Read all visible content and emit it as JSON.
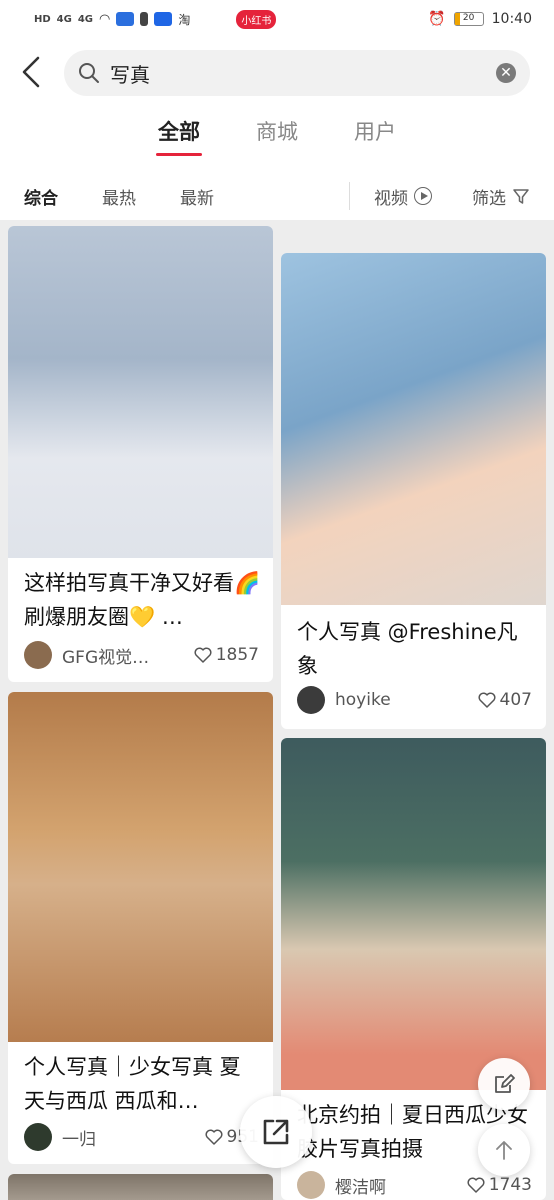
{
  "status_bar": {
    "network": "HD",
    "signal1": "4G",
    "signal2": "4G",
    "app_badge": "小红书",
    "battery": "20",
    "time": "10:40"
  },
  "search": {
    "query": "写真"
  },
  "tabs": [
    {
      "label": "全部",
      "active": true
    },
    {
      "label": "商城",
      "active": false
    },
    {
      "label": "用户",
      "active": false
    }
  ],
  "filters": {
    "items": [
      "综合",
      "最热",
      "最新"
    ],
    "video_label": "视频",
    "screen_label": "筛选"
  },
  "cards": [
    {
      "title": "这样拍写真干净又好看🌈刷爆朋友圈💛 …",
      "author": "GFG视觉…",
      "likes": "1857"
    },
    {
      "title": "个人写真 @Freshine凡象",
      "author": "hoyike",
      "likes": "407"
    },
    {
      "title": "个人写真｜少女写真 夏天与西瓜 西瓜和…",
      "author": "一归",
      "likes": "951"
    },
    {
      "title": "北京约拍｜夏日西瓜少女胶片写真拍摄",
      "author": "樱洁啊",
      "likes": "1743"
    }
  ],
  "colors": {
    "accent": "#e5233b",
    "text": "#222222",
    "muted": "#888888"
  }
}
